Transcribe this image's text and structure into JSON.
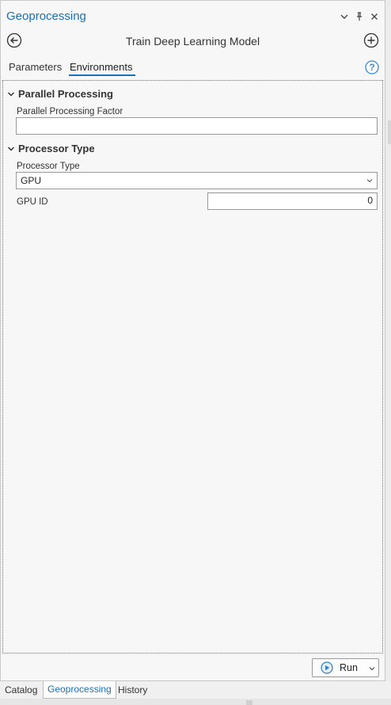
{
  "pane": {
    "title": "Geoprocessing",
    "controls": {
      "menu_icon": "chevron-down-icon",
      "pin_icon": "pin-icon",
      "close_icon": "close-icon"
    }
  },
  "toolbar": {
    "back_icon": "back-arrow-icon",
    "tool_title": "Train Deep Learning Model",
    "add_icon": "add-icon"
  },
  "tabs": [
    {
      "label": "Parameters",
      "active": false
    },
    {
      "label": "Environments",
      "active": true
    }
  ],
  "help_icon": "help-icon",
  "sections": {
    "parallel": {
      "title": "Parallel Processing",
      "factor_label": "Parallel Processing Factor",
      "factor_value": ""
    },
    "processor": {
      "title": "Processor Type",
      "type_label": "Processor Type",
      "type_value": "GPU",
      "gpu_label": "GPU ID",
      "gpu_value": "0"
    }
  },
  "footer": {
    "run_label": "Run",
    "run_icon": "play-icon"
  },
  "bottom_tabs": [
    {
      "label": "Catalog",
      "active": false
    },
    {
      "label": "Geoprocessing",
      "active": true
    },
    {
      "label": "History",
      "active": false
    }
  ],
  "colors": {
    "accent": "#1a6fb8",
    "panel_bg": "#f6f7f6",
    "border": "#9a9a9a"
  }
}
